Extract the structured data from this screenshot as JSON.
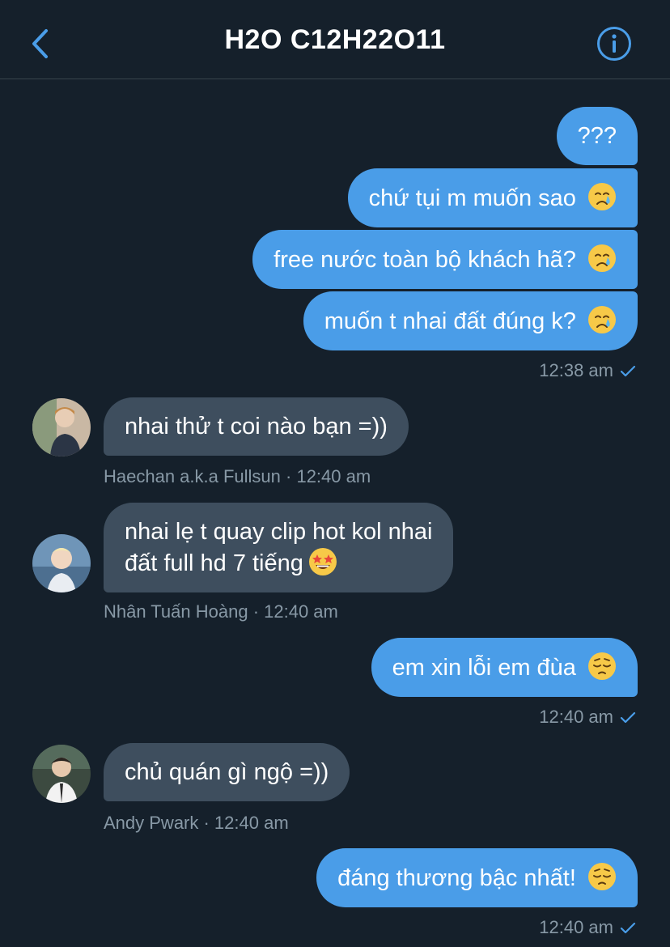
{
  "header": {
    "title": "H2O C12H22O11",
    "back_icon": "chevron-left-icon",
    "info_icon": "info-icon",
    "accent_color": "#4a9de8"
  },
  "messages": [
    {
      "side": "out",
      "text": "???"
    },
    {
      "side": "out",
      "text": "chứ tụi m muốn sao",
      "emoji": "crying-face"
    },
    {
      "side": "out",
      "text": "free nước toàn bộ khách hã?",
      "emoji": "crying-face"
    },
    {
      "side": "out",
      "text": "muốn t nhai đất đúng k?",
      "emoji": "crying-face"
    },
    {
      "side": "in",
      "text": "nhai thử t coi nào bạn =))"
    },
    {
      "side": "in",
      "line1": "nhai lẹ t quay clip hot kol nhai",
      "line2": "đất full hd 7 tiếng",
      "emoji": "star-struck"
    },
    {
      "side": "out",
      "text": "em xin lỗi em đùa",
      "emoji": "pensive-face"
    },
    {
      "side": "in",
      "text": "chủ quán gì ngộ =))"
    },
    {
      "side": "out",
      "text": "đáng thương bậc nhất!",
      "emoji": "pensive-face"
    }
  ],
  "meta": {
    "sent_1": "12:38 am",
    "from_1": "Haechan a.k.a Fullsun · 12:40 am",
    "from_2": "Nhân Tuấn Hoàng · 12:40 am",
    "sent_2": "12:40 am",
    "from_3": "Andy Pwark · 12:40 am",
    "sent_3": "12:40 am"
  },
  "colors": {
    "background": "#15202b",
    "outgoing_bubble": "#4a9de8",
    "incoming_bubble": "#3e4e5e",
    "meta_text": "#8899a6"
  }
}
